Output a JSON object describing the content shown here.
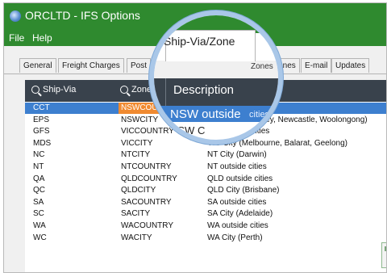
{
  "window": {
    "title": "ORCLTD - IFS Options"
  },
  "menu": [
    "File",
    "Help"
  ],
  "tabs": [
    "General",
    "Freight Charges",
    "Post",
    "Zones",
    "E-mail",
    "Updates"
  ],
  "active_tab": "Ship-Via/Zone",
  "columns": {
    "ship_via": "Ship-Via",
    "zone": "Zone",
    "description": "Description"
  },
  "rows": [
    {
      "ship_via": "CCT",
      "zone": "NSWCOUN",
      "description": "NSW outside cities"
    },
    {
      "ship_via": "EPS",
      "zone": "NSWCITY",
      "description": "NSW City (Sydney, Newcastle, Woolongong)"
    },
    {
      "ship_via": "GFS",
      "zone": "VICCOUNTRY",
      "description": "VIC outside cities"
    },
    {
      "ship_via": "MDS",
      "zone": "VICCITY",
      "description": "VIC City (Melbourne, Balarat, Geelong)"
    },
    {
      "ship_via": "NC",
      "zone": "NTCITY",
      "description": "NT City (Darwin)"
    },
    {
      "ship_via": "NT",
      "zone": "NTCOUNTRY",
      "description": "NT outside cities"
    },
    {
      "ship_via": "QA",
      "zone": "QLDCOUNTRY",
      "description": "QLD outside cities"
    },
    {
      "ship_via": "QC",
      "zone": "QLDCITY",
      "description": "QLD City (Brisbane)"
    },
    {
      "ship_via": "SA",
      "zone": "SACOUNTRY",
      "description": "SA outside cities"
    },
    {
      "ship_via": "SC",
      "zone": "SACITY",
      "description": "SA City (Adelaide)"
    },
    {
      "ship_via": "WA",
      "zone": "WACOUNTRY",
      "description": "WA outside cities"
    },
    {
      "ship_via": "WC",
      "zone": "WACITY",
      "description": "WA City (Perth)"
    }
  ],
  "magnifier": {
    "selected_prefix": "NSW outside",
    "selected_suffix": "cities",
    "row2_prefix": "NSW C"
  },
  "colors": {
    "title_bar": "#2f8a2f",
    "header": "#39424c",
    "selection": "#3d7fcf",
    "zone_highlight": "#f08a30",
    "lens_border": "#a9c7e8"
  }
}
